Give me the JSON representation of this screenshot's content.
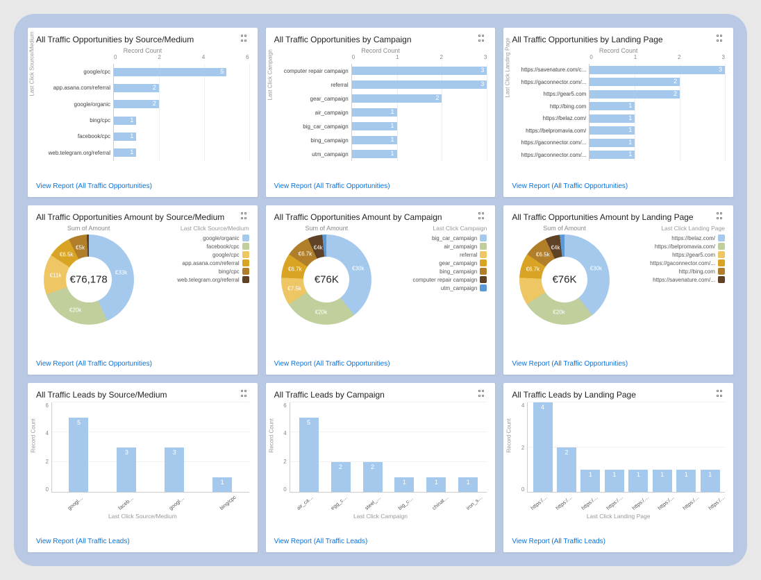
{
  "colors": {
    "bar": "#a5c9ed",
    "donut": [
      "#a5c9ed",
      "#c1cf9c",
      "#eec664",
      "#d9a324",
      "#b17e2a",
      "#5f4125",
      "#5c99d6"
    ]
  },
  "cards": [
    {
      "id": "opp_source",
      "title": "All Traffic Opportunities by Source/Medium",
      "link": "View Report (All Traffic Opportunities)",
      "chart_data": {
        "type": "bar",
        "orientation": "horizontal",
        "axis_title": "Record Count",
        "y_axis_label": "Last Click Source/Medium",
        "xlim": [
          0,
          6
        ],
        "ticks": [
          0,
          2,
          4,
          6
        ],
        "categories": [
          "google/cpc",
          "app.asana.com/referral",
          "google/organic",
          "bing/cpc",
          "facebook/cpc",
          "web.telegram.org/referral"
        ],
        "values": [
          5,
          2,
          2,
          1,
          1,
          1
        ]
      }
    },
    {
      "id": "opp_campaign",
      "title": "All Traffic Opportunities by Campaign",
      "link": "View Report (All Traffic Opportunities)",
      "chart_data": {
        "type": "bar",
        "orientation": "horizontal",
        "axis_title": "Record Count",
        "y_axis_label": "Last Click Campaign",
        "xlim": [
          0,
          3
        ],
        "ticks": [
          0,
          1,
          2,
          3
        ],
        "categories": [
          "computer repair campaign",
          "referral",
          "gear_campaign",
          "air_campaign",
          "big_car_campaign",
          "bing_campaign",
          "utm_campaign"
        ],
        "values": [
          3,
          3,
          2,
          1,
          1,
          1,
          1
        ]
      }
    },
    {
      "id": "opp_landing",
      "title": "All Traffic Opportunities by Landing Page",
      "link": "View Report (All Traffic Opportunities)",
      "chart_data": {
        "type": "bar",
        "orientation": "horizontal",
        "axis_title": "Record Count",
        "y_axis_label": "Last Click Landing Page",
        "xlim": [
          0,
          3
        ],
        "ticks": [
          0,
          1,
          2,
          3
        ],
        "categories": [
          "https://savenature.com/c...",
          "https://gaconnector.com/...",
          "https://gear5.com",
          "http://bing.com",
          "https://belaz.com/",
          "https://belpromavia.com/",
          "https://gaconnector.com/...",
          "https://gaconnector.com/..."
        ],
        "values": [
          3,
          2,
          2,
          1,
          1,
          1,
          1,
          1
        ]
      }
    },
    {
      "id": "amt_source",
      "title": "All Traffic Opportunities Amount by Source/Medium",
      "link": "View Report (All Traffic Opportunities)",
      "chart_data": {
        "type": "pie",
        "title": "Sum of Amount",
        "center": "€76,178",
        "legend_title": "Last Click Source/Medium",
        "series": [
          {
            "name": "google/organic",
            "label": "€33k",
            "value": 33
          },
          {
            "name": "facebook/cpc",
            "label": "€20k",
            "value": 20
          },
          {
            "name": "google/cpc",
            "label": "€11k",
            "value": 11
          },
          {
            "name": "app.asana.com/referral",
            "label": "€6.5k",
            "value": 6.5
          },
          {
            "name": "bing/cpc",
            "label": "€5k",
            "value": 5
          },
          {
            "name": "web.telegram.org/referral",
            "label": "",
            "value": 0.6
          }
        ]
      }
    },
    {
      "id": "amt_campaign",
      "title": "All Traffic Opportunities Amount by Campaign",
      "link": "View Report (All Traffic Opportunities)",
      "chart_data": {
        "type": "pie",
        "title": "Sum of Amount",
        "center": "€76K",
        "legend_title": "Last Click Campaign",
        "series": [
          {
            "name": "big_car_campaign",
            "label": "€30k",
            "value": 30
          },
          {
            "name": "air_campaign",
            "label": "€20k",
            "value": 20
          },
          {
            "name": "referral",
            "label": "€7.5k",
            "value": 7.5
          },
          {
            "name": "gear_campaign",
            "label": "€6.7k",
            "value": 6.7
          },
          {
            "name": "bing_campaign",
            "label": "€6.7k",
            "value": 6.7
          },
          {
            "name": "computer repair campaign",
            "label": "€4k",
            "value": 4
          },
          {
            "name": "utm_campaign",
            "label": "",
            "value": 1.1
          }
        ]
      }
    },
    {
      "id": "amt_landing",
      "title": "All Traffic Opportunities Amount by Landing Page",
      "link": "View Report (All Traffic Opportunities)",
      "chart_data": {
        "type": "pie",
        "title": "Sum of Amount",
        "center": "€76K",
        "legend_title": "Last Click Landing Page",
        "series": [
          {
            "name": "https://belaz.com/",
            "label": "€30k",
            "value": 30
          },
          {
            "name": "https://belpromavia.com/",
            "label": "€20k",
            "value": 20
          },
          {
            "name": "https://gear5.com",
            "label": "",
            "value": 7.5
          },
          {
            "name": "https://gaconnector.com/...",
            "label": "€6.7k",
            "value": 6.7
          },
          {
            "name": "http://bing.com",
            "label": "€6.5k",
            "value": 6.5
          },
          {
            "name": "https://savenature.com/...",
            "label": "€4k",
            "value": 4
          },
          {
            "name": "",
            "label": "",
            "value": 1.3
          }
        ]
      }
    },
    {
      "id": "leads_source",
      "title": "All Traffic Leads by Source/Medium",
      "link": "View Report (All Traffic Leads)",
      "chart_data": {
        "type": "bar",
        "orientation": "vertical",
        "y_axis_label": "Record Count",
        "x_axis_label": "Last Click Source/Medium",
        "ylim": [
          0,
          6
        ],
        "yticks": [
          0,
          2,
          4,
          6
        ],
        "categories": [
          "google/organic",
          "facebook/cpc",
          "google/cpc",
          "bing/cpc"
        ],
        "values": [
          5,
          3,
          3,
          1
        ]
      }
    },
    {
      "id": "leads_campaign",
      "title": "All Traffic Leads by Campaign",
      "link": "View Report (All Traffic Leads)",
      "chart_data": {
        "type": "bar",
        "orientation": "vertical",
        "y_axis_label": "Record Count",
        "x_axis_label": "Last Click Campaign",
        "ylim": [
          0,
          6
        ],
        "yticks": [
          0,
          2,
          4,
          6
        ],
        "categories": [
          "air_campaign",
          "egg_campaign",
          "steel_campai...",
          "big_car_cam...",
          "chinatown_c...",
          "iron_steel_ca..."
        ],
        "values": [
          5,
          2,
          2,
          1,
          1,
          1
        ]
      }
    },
    {
      "id": "leads_landing",
      "title": "All Traffic Leads by Landing Page",
      "link": "View Report (All Traffic Leads)",
      "chart_data": {
        "type": "bar",
        "orientation": "vertical",
        "y_axis_label": "Record Count",
        "x_axis_label": "Last Click Landing Page",
        "ylim": [
          0,
          4
        ],
        "yticks": [
          0,
          2,
          4
        ],
        "categories": [
          "https://savea...",
          "https://veryfr...",
          "https://faceb...",
          "https://belaz...",
          "https://buyst...",
          "https://faceb...",
          "https://ddiq...",
          "https://tramc..."
        ],
        "values": [
          4,
          2,
          1,
          1,
          1,
          1,
          1,
          1
        ]
      }
    }
  ]
}
